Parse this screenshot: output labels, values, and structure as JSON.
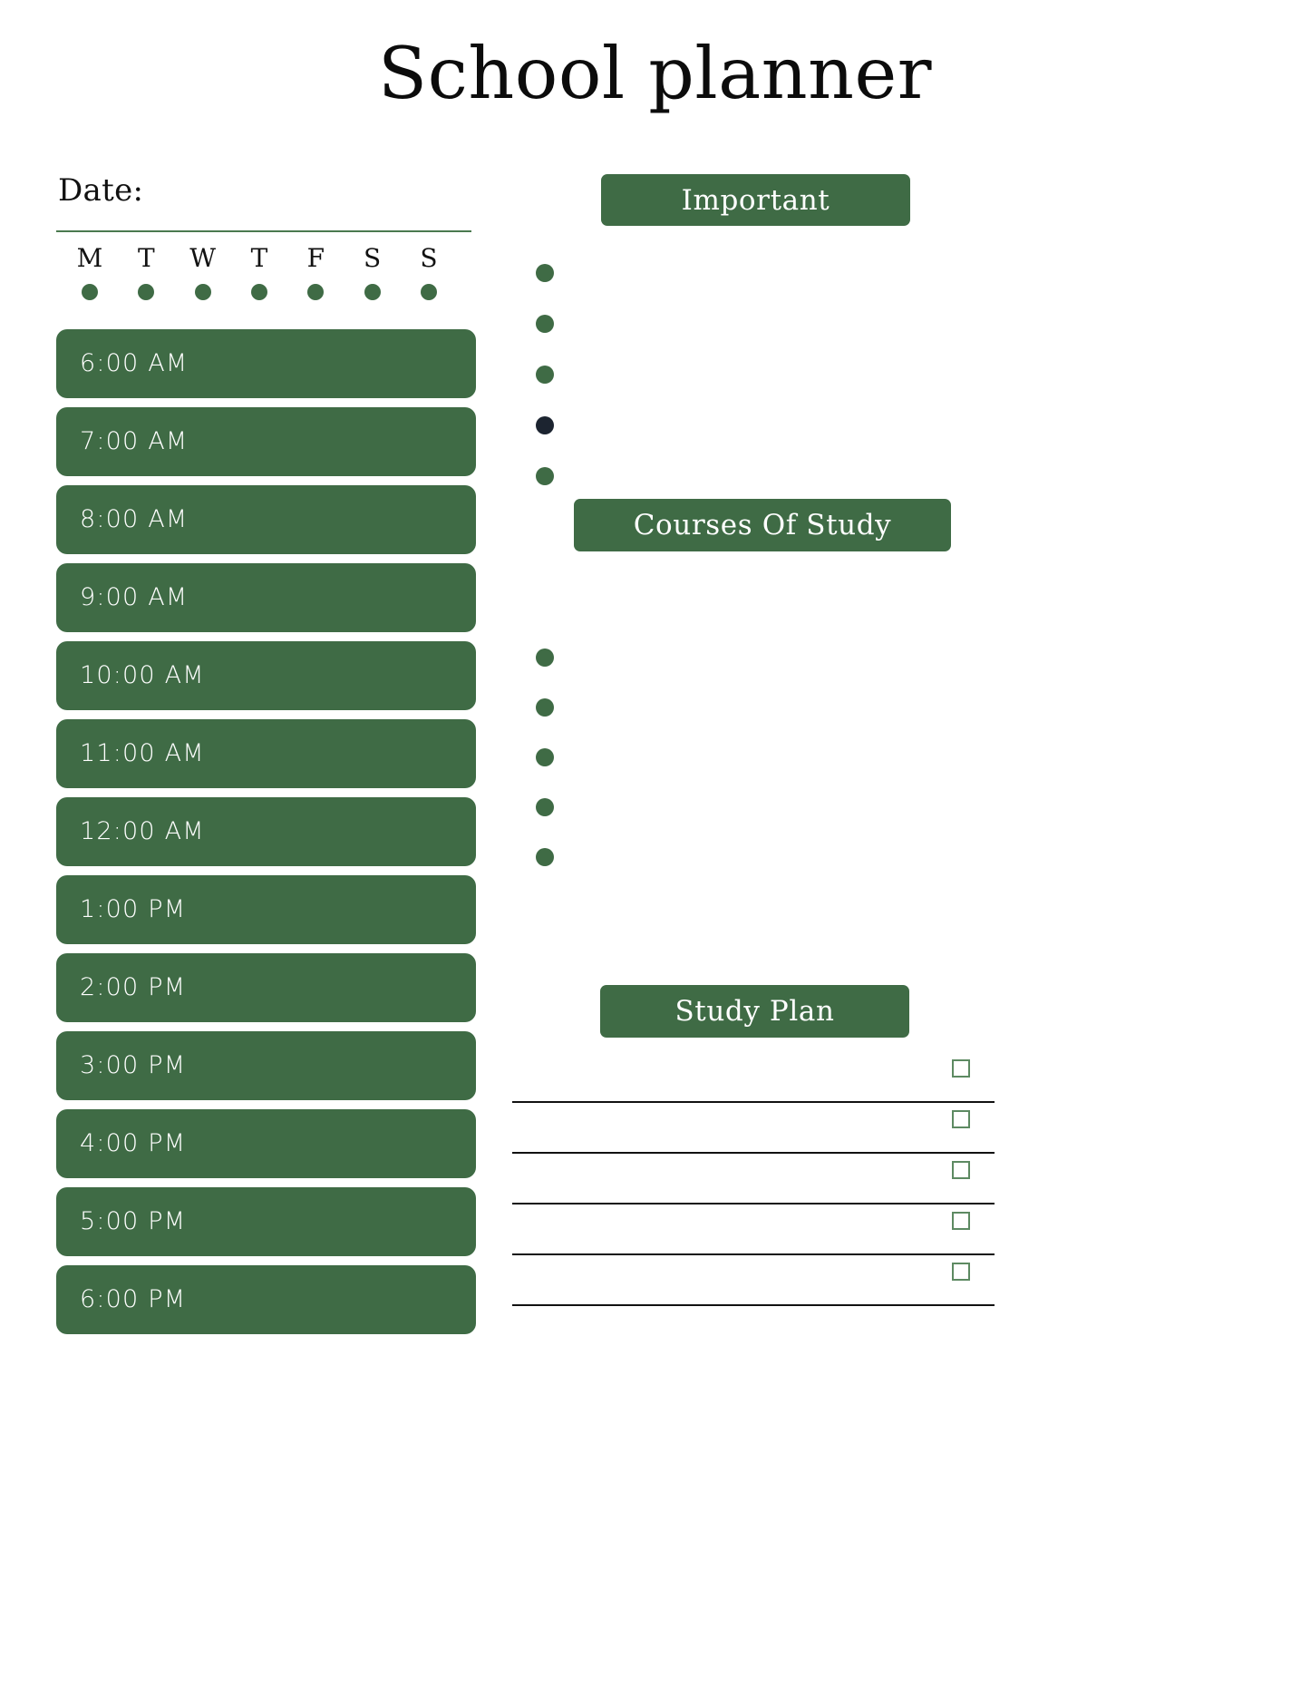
{
  "document": {
    "title": "School planner"
  },
  "left_panel": {
    "date_label": "Date:",
    "days": [
      {
        "letter": "M",
        "dot": "day-dot"
      },
      {
        "letter": "T",
        "dot": "day-dot"
      },
      {
        "letter": "W",
        "dot": "day-dot"
      },
      {
        "letter": "T",
        "dot": "day-dot"
      },
      {
        "letter": "F",
        "dot": "day-dot"
      },
      {
        "letter": "S",
        "dot": "day-dot"
      },
      {
        "letter": "S",
        "dot": "day-dot"
      }
    ],
    "time_slots": [
      "6:00 AM",
      "7:00 AM",
      "8:00 AM",
      "9:00 AM",
      "10:00 AM",
      "11:00 AM",
      "12:00 AM",
      "1:00 PM",
      "2:00 PM",
      "3:00 PM",
      "4:00 PM",
      "5:00 PM",
      "6:00 PM"
    ]
  },
  "right_panel": {
    "important": {
      "heading": "Important",
      "bullets": [
        {
          "index": 1,
          "color": "#3f6b45",
          "filled": true
        },
        {
          "index": 2,
          "color": "#3f6b45",
          "filled": true
        },
        {
          "index": 3,
          "color": "#3f6b45",
          "filled": true
        },
        {
          "index": 4,
          "color": "#1c2430",
          "filled": true
        },
        {
          "index": 5,
          "color": "#3f6b45",
          "filled": true
        }
      ]
    },
    "courses_of_study": {
      "heading": "Courses Of Study",
      "bullets": [
        {
          "index": 1,
          "color": "#3f6b45",
          "filled": true
        },
        {
          "index": 2,
          "color": "#3f6b45",
          "filled": true
        },
        {
          "index": 3,
          "color": "#3f6b45",
          "filled": true
        },
        {
          "index": 4,
          "color": "#3f6b45",
          "filled": true
        },
        {
          "index": 5,
          "color": "#3f6b45",
          "filled": true
        }
      ]
    },
    "study_plan": {
      "heading": "Study Plan",
      "rows": [
        {
          "index": 1,
          "text": "",
          "checked": false
        },
        {
          "index": 2,
          "text": "",
          "checked": false
        },
        {
          "index": 3,
          "text": "",
          "checked": false
        },
        {
          "index": 4,
          "text": "",
          "checked": false
        },
        {
          "index": 5,
          "text": "",
          "checked": false
        }
      ]
    }
  },
  "theme": {
    "accent_green": "#3f6b45",
    "rule_green": "#4a7a4f",
    "dark_navy": "#1c2430",
    "text_dark": "#111111",
    "text_light": "#ffffff",
    "page_background": "#ffffff"
  }
}
